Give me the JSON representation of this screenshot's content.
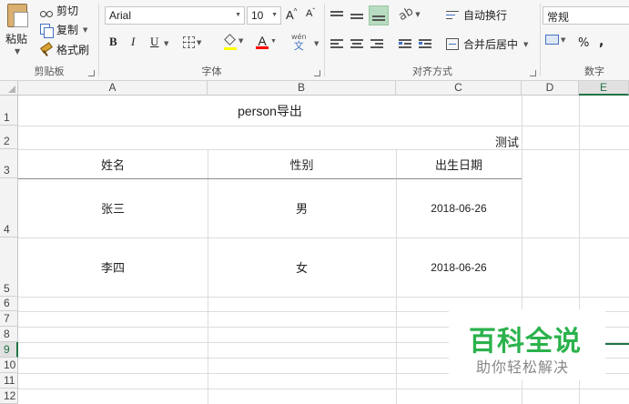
{
  "ribbon": {
    "clipboard": {
      "paste_label": "粘贴",
      "cut_label": "剪切",
      "copy_label": "复制",
      "format_painter_label": "格式刷",
      "group_label": "剪贴板"
    },
    "font": {
      "font_name": "Arial",
      "font_size": "10",
      "bold": "B",
      "italic": "I",
      "underline": "U",
      "grow": "A",
      "shrink": "A",
      "font_color_glyph": "A",
      "phonetic_top": "wén",
      "phonetic_bottom": "文",
      "group_label": "字体",
      "fill_color": "#ffff00",
      "font_color": "#ff0000"
    },
    "alignment": {
      "wrap_text_label": "自动换行",
      "merge_center_label": "合并后居中",
      "group_label": "对齐方式"
    },
    "number": {
      "format": "常规",
      "percent": "%",
      "comma": ",",
      "group_label": "数字"
    }
  },
  "columns": [
    "A",
    "B",
    "C",
    "D",
    "E"
  ],
  "rows": [
    "1",
    "2",
    "3",
    "4",
    "5",
    "6",
    "7",
    "8",
    "9",
    "10",
    "11",
    "12"
  ],
  "selected_column": "E",
  "selected_row": "9",
  "sheet": {
    "title": "person导出",
    "subtitle": "测试",
    "headers": [
      "姓名",
      "性别",
      "出生日期"
    ],
    "records": [
      [
        "张三",
        "男",
        "2018-06-26"
      ],
      [
        "李四",
        "女",
        "2018-06-26"
      ]
    ]
  },
  "watermark": {
    "title": "百科全说",
    "subtitle": "助你轻松解决"
  },
  "colors": {
    "accent": "#217346",
    "watermark_green": "#2bb24c"
  }
}
